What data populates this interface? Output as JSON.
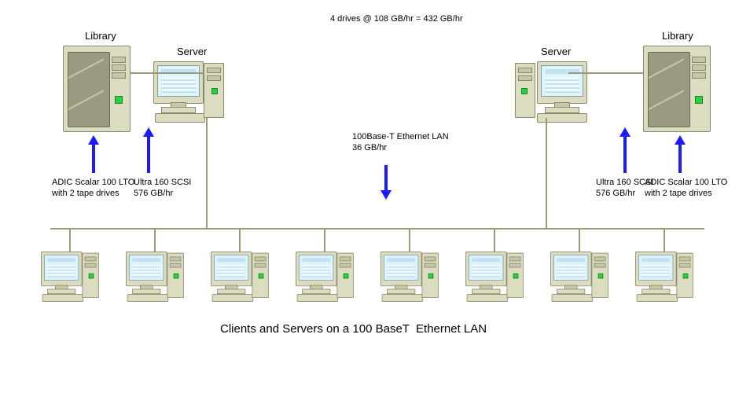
{
  "top_note": "4 drives @ 108 GB/hr = 432 GB/hr",
  "left": {
    "library_title": "Library",
    "server_title": "Server",
    "library_caption": "ADIC Scalar 100 LTO\nwith 2 tape drives",
    "scsi_caption": "Ultra 160 SCSI\n576 GB/hr"
  },
  "right": {
    "library_title": "Library",
    "server_title": "Server",
    "library_caption": "ADIC Scalar 100 LTO\nwith 2 tape drives",
    "scsi_caption": "Ultra 160 SCSI\n576 GB/hr"
  },
  "center": {
    "lan_caption": "100Base-T Ethernet LAN\n36 GB/hr"
  },
  "bottom_caption": "Clients and Servers on a 100 BaseT  Ethernet LAN",
  "client_count": 8
}
